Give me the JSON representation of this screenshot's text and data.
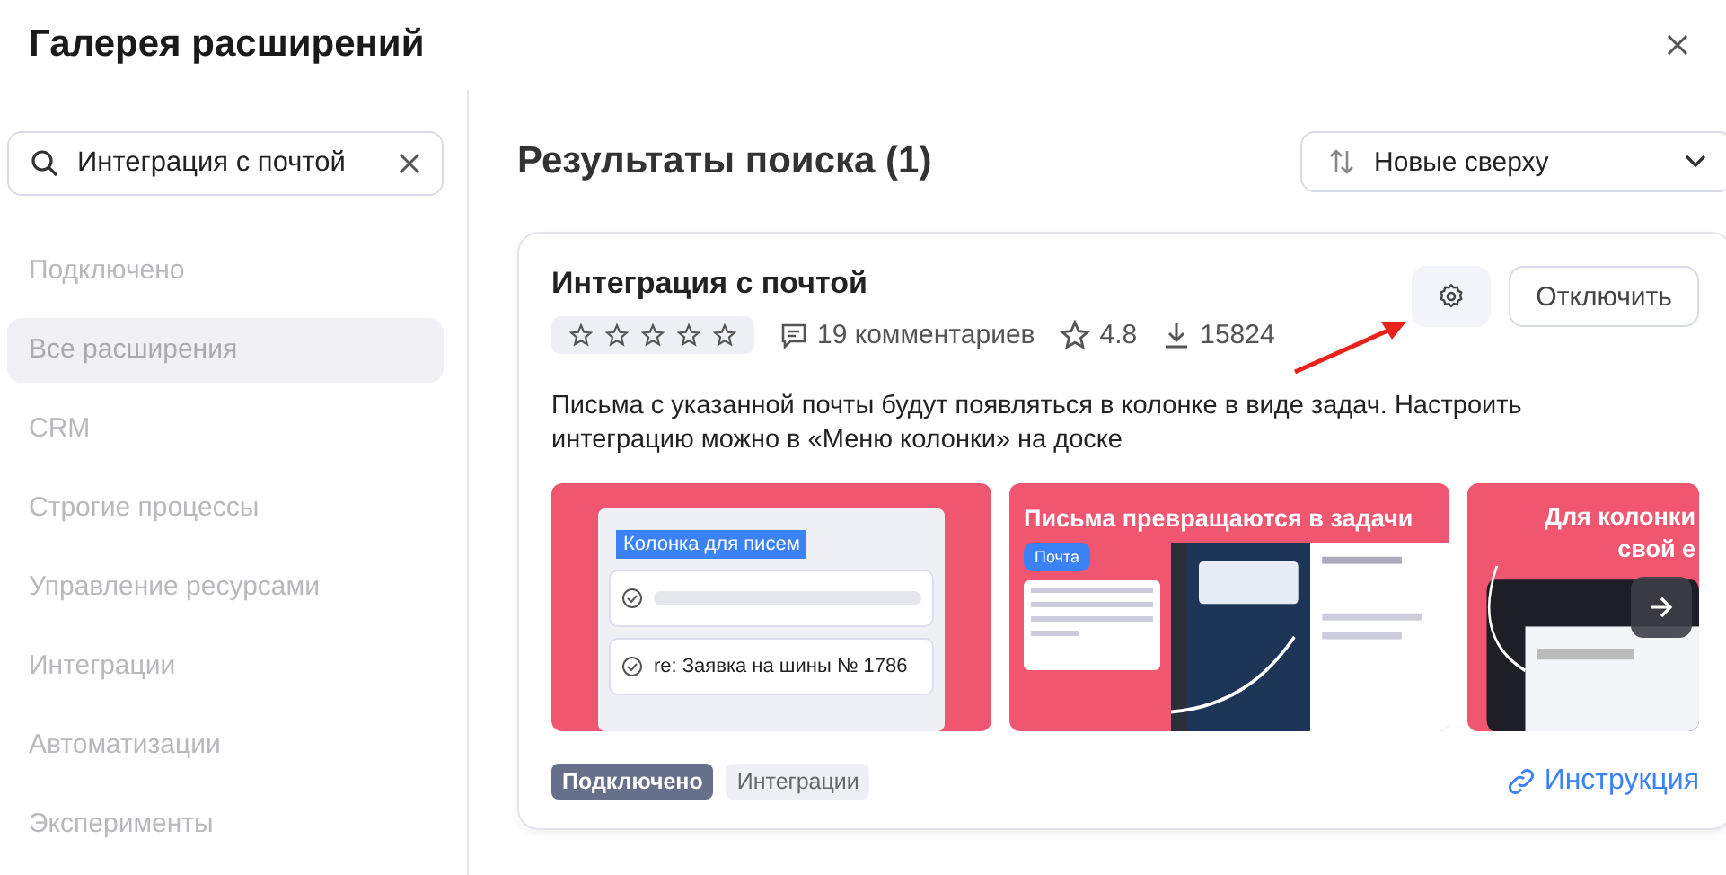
{
  "window": {
    "title": "Галерея расширений"
  },
  "search": {
    "value": "Интеграция с почтой"
  },
  "sidebar": {
    "items": [
      {
        "label": "Подключено",
        "selected": false
      },
      {
        "label": "Все расширения",
        "selected": true
      },
      {
        "label": "CRM",
        "selected": false
      },
      {
        "label": "Строгие процессы",
        "selected": false
      },
      {
        "label": "Управление ресурсами",
        "selected": false
      },
      {
        "label": "Интеграции",
        "selected": false
      },
      {
        "label": "Автоматизации",
        "selected": false
      },
      {
        "label": "Эксперименты",
        "selected": false
      }
    ]
  },
  "results": {
    "heading": "Результаты поиска (1)",
    "sort": "Новые сверху"
  },
  "extension": {
    "title": "Интеграция с почтой",
    "stars": 0,
    "comments": "19 комментариев",
    "rating": "4.8",
    "downloads": "15824",
    "action": "Отключить",
    "description": "Письма с указанной почты будут появляться в колонке в виде задач. Настроить интеграцию можно в «Меню колонки» на доске",
    "slides": [
      {
        "kind": "column",
        "label": "Колонка для писем",
        "item": "re: Заявка на шины № 1786"
      },
      {
        "kind": "mail",
        "title": "Письма превращаются в задачи",
        "badge": "Почта"
      },
      {
        "kind": "dark",
        "title_lines": [
          "Для колонки",
          "свой е"
        ]
      }
    ],
    "tags": [
      {
        "label": "Подключено",
        "kind": "status"
      },
      {
        "label": "Интеграции",
        "kind": "category"
      }
    ],
    "link": "Инструкция"
  }
}
